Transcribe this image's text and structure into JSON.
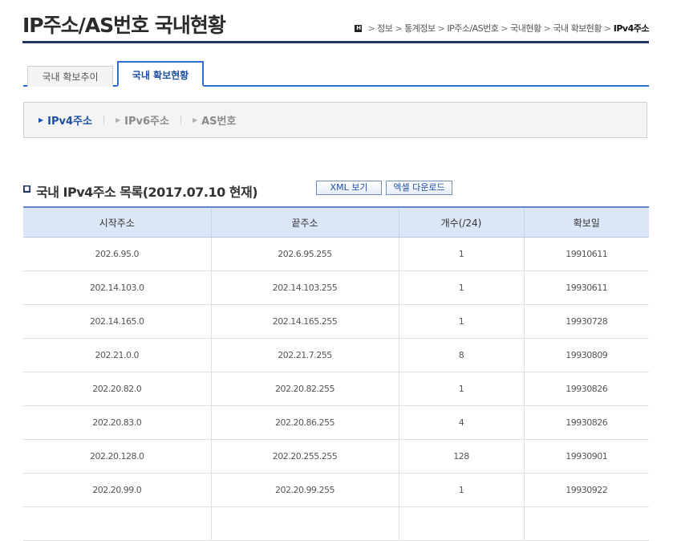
{
  "page": {
    "title": "IP주소/AS번호 국내현황",
    "breadcrumb": {
      "home_icon": "home-icon",
      "items": [
        "정보",
        "통계정보",
        "IP주소/AS번호",
        "국내현황",
        "국내 확보현황"
      ],
      "current": "IPv4주소",
      "separator": ">"
    }
  },
  "tabs": [
    {
      "label": "국내 확보추이",
      "active": false
    },
    {
      "label": "국내 확보현황",
      "active": true
    }
  ],
  "subnav": [
    {
      "label": "IPv4주소",
      "active": true
    },
    {
      "label": "IPv6주소",
      "active": false
    },
    {
      "label": "AS번호",
      "active": false
    }
  ],
  "section": {
    "title": "국내 IPv4주소 목록(2017.07.10 현재)",
    "xml_button": "XML 보기",
    "excel_button": "엑셀 다운로드"
  },
  "table": {
    "headers": [
      "시작주소",
      "끝주소",
      "개수(/24)",
      "확보일"
    ],
    "rows": [
      [
        "202.6.95.0",
        "202.6.95.255",
        "1",
        "19910611"
      ],
      [
        "202.14.103.0",
        "202.14.103.255",
        "1",
        "19930611"
      ],
      [
        "202.14.165.0",
        "202.14.165.255",
        "1",
        "19930728"
      ],
      [
        "202.21.0.0",
        "202.21.7.255",
        "8",
        "19930809"
      ],
      [
        "202.20.82.0",
        "202.20.82.255",
        "1",
        "19930826"
      ],
      [
        "202.20.83.0",
        "202.20.86.255",
        "4",
        "19930826"
      ],
      [
        "202.20.128.0",
        "202.20.255.255",
        "128",
        "19930901"
      ],
      [
        "202.20.99.0",
        "202.20.99.255",
        "1",
        "19930922"
      ],
      [
        "",
        "",
        "",
        ""
      ]
    ]
  },
  "colors": {
    "accent": "#2b6fd1",
    "navy": "#1f3564",
    "header_bg": "#dbe6f6"
  }
}
